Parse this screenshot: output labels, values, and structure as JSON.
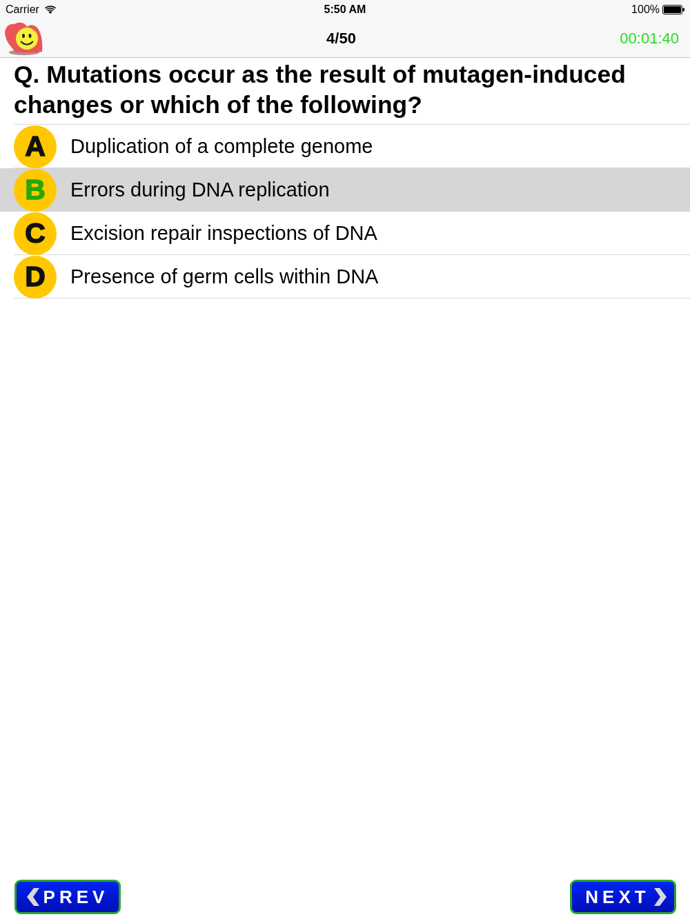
{
  "status_bar": {
    "carrier": "Carrier",
    "time": "5:50 AM",
    "battery": "100%"
  },
  "header": {
    "progress": "4/50",
    "timer": "00:01:40"
  },
  "question": "Q. Mutations occur as the result of mutagen-induced changes or which of the following?",
  "options": [
    {
      "letter": "A",
      "text": "Duplication of a complete genome",
      "selected": false
    },
    {
      "letter": "B",
      "text": "Errors during DNA replication",
      "selected": true
    },
    {
      "letter": "C",
      "text": "Excision repair inspections of DNA",
      "selected": false
    },
    {
      "letter": "D",
      "text": "Presence of germ cells within DNA",
      "selected": false
    }
  ],
  "buttons": [
    {
      "kind": "prev",
      "label": "PREV"
    },
    {
      "kind": "next",
      "label": "NEXT"
    }
  ]
}
